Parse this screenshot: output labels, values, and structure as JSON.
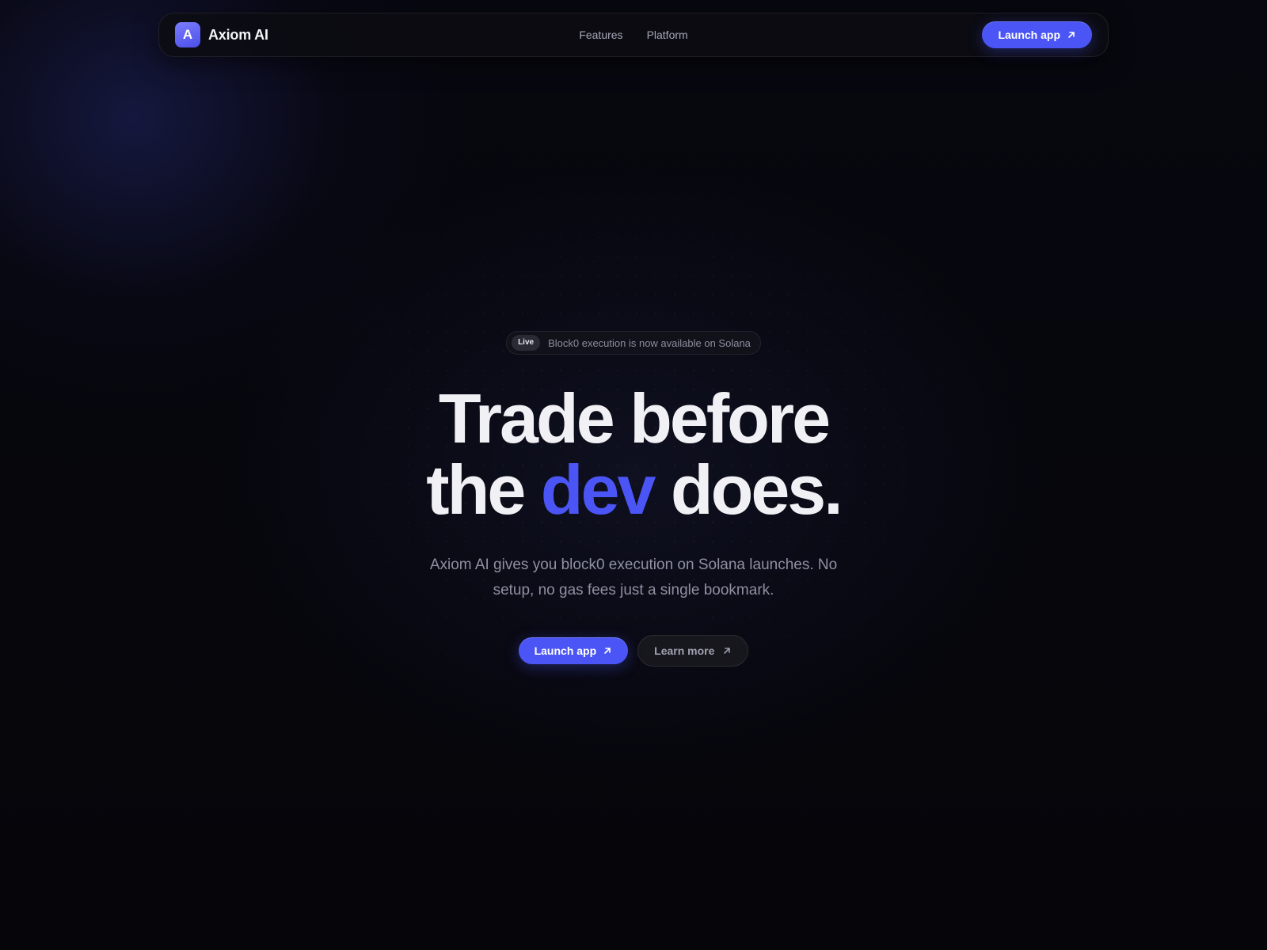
{
  "nav": {
    "logo_letter": "A",
    "brand": "Axiom AI",
    "links": [
      "Features",
      "Platform"
    ],
    "cta": "Launch app"
  },
  "hero": {
    "badge": "Live",
    "announcement": "Block0 execution is now available on Solana",
    "headline_line1": "Trade before",
    "headline_line2_pre": "the",
    "headline_accent": "dev",
    "headline_line2_post": "does.",
    "subtitle": "Axiom AI gives you block0 execution on Solana launches. No setup, no gas fees just a single bookmark.",
    "primary_cta": "Launch app",
    "secondary_cta": "Learn more"
  },
  "icons": {
    "cta_arrow": "arrow-up-right-icon"
  },
  "colors": {
    "accent": "#4b55f5",
    "background": "#06060c",
    "text": "#f1f1f5",
    "muted": "#8f90a2"
  }
}
